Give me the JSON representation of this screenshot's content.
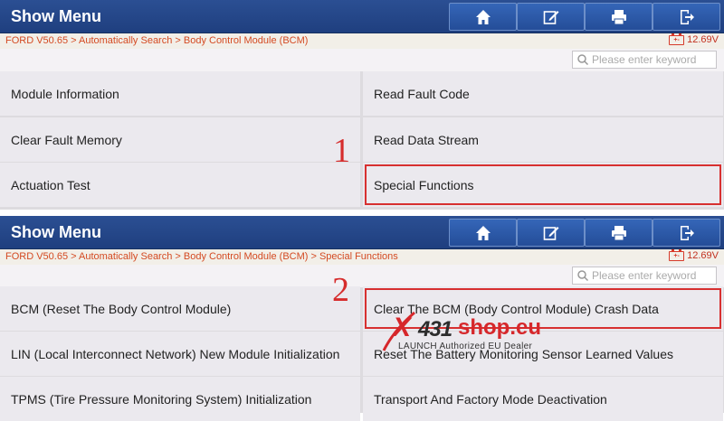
{
  "panels": [
    {
      "title": "Show Menu",
      "breadcrumb": "FORD V50.65 > Automatically Search > Body Control Module (BCM)",
      "battery": "12.69V",
      "battery_icon_text": "+-",
      "search_placeholder": "Please enter keyword",
      "items": [
        "Module Information",
        "Read Fault Code",
        "Clear Fault Memory",
        "Read Data Stream",
        "Actuation Test",
        "Special Functions"
      ],
      "step_marker": "1"
    },
    {
      "title": "Show Menu",
      "breadcrumb": "FORD V50.65 > Automatically Search > Body Control Module (BCM) > Special Functions",
      "battery": "12.69V",
      "battery_icon_text": "+-",
      "search_placeholder": "Please enter keyword",
      "items": [
        "BCM (Reset The Body Control Module)",
        "Clear The BCM (Body Control Module) Crash Data",
        "LIN (Local Interconnect Network) New Module Initialization",
        "Reset The Battery Monitoring Sensor Learned Values",
        "TPMS (Tire Pressure Monitoring System) Initialization",
        "Transport And Factory Mode Deactivation"
      ],
      "step_marker": "2"
    }
  ],
  "toolbar_icons": [
    "home-icon",
    "edit-icon",
    "print-icon",
    "exit-icon"
  ],
  "watermark": {
    "x": "X",
    "num": "431",
    "shop": "shop.eu",
    "subtitle": "LAUNCH Authorized EU Dealer"
  },
  "colors": {
    "header": "#244a8c",
    "highlight": "#d73030",
    "breadcrumb_text": "#d44a22",
    "cell_bg": "#ebe9ee"
  }
}
